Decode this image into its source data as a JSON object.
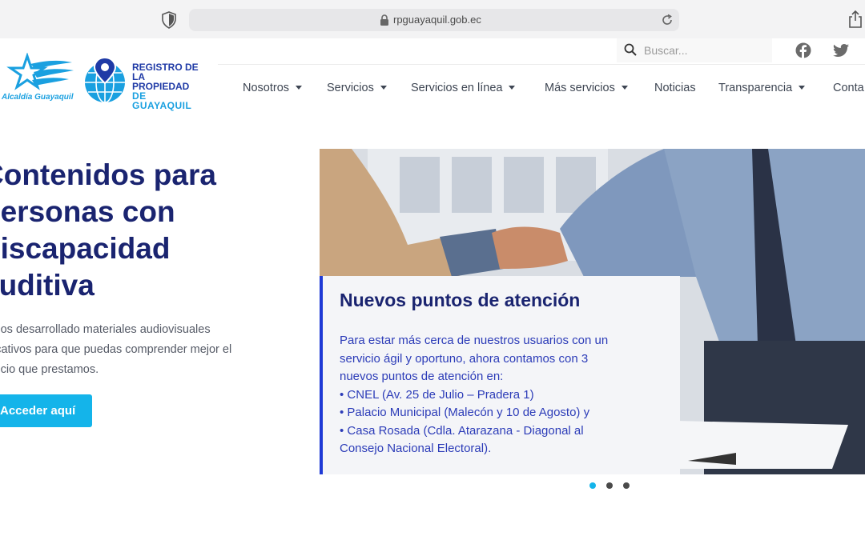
{
  "browser": {
    "url": "rpguayaquil.gob.ec",
    "icons": [
      "shield-icon",
      "lock-icon",
      "reload-icon",
      "share-icon"
    ]
  },
  "header": {
    "alcaldia_logo_text": "Alcaldía Guayaquil",
    "registro_logo": [
      "REGISTRO DE",
      "LA PROPIEDAD",
      "DE GUAYAQUIL"
    ],
    "search_placeholder": "Buscar...",
    "social": [
      "facebook-icon",
      "twitter-icon"
    ]
  },
  "nav": {
    "items": [
      {
        "label": "Nosotros",
        "dropdown": true
      },
      {
        "label": "Servicios",
        "dropdown": true
      },
      {
        "label": "Servicios en línea",
        "dropdown": true
      },
      {
        "label": "Más servicios",
        "dropdown": true
      },
      {
        "label": "Noticias",
        "dropdown": false
      },
      {
        "label": "Transparencia",
        "dropdown": true
      },
      {
        "label": "Conta",
        "dropdown": false
      }
    ]
  },
  "hero": {
    "title_lines": [
      "Contenidos para",
      "personas con",
      "discapacidad",
      "auditiva"
    ],
    "body_lines": [
      "Hemos desarrollado materiales audiovisuales",
      "educativos para que puedas comprender mejor el",
      "servicio que prestamos."
    ],
    "button": "Acceder aquí"
  },
  "slide": {
    "title": "Nuevos puntos de atención",
    "lines": [
      "Para estar más cerca de nuestros usuarios con un",
      "servicio ágil y oportuno, ahora contamos con 3",
      "nuevos puntos de atención en:",
      "• CNEL (Av. 25 de Julio – Pradera 1)",
      "• Palacio Municipal (Malecón y 10 de Agosto) y",
      "• Casa Rosada (Cdla. Atarazana - Diagonal al",
      "Consejo Nacional Electoral)."
    ],
    "active_index": 0,
    "count": 3
  },
  "colors": {
    "brand_navy": "#1a2470",
    "brand_cyan": "#14b4ea",
    "accent_blue": "#1f3ad6"
  }
}
